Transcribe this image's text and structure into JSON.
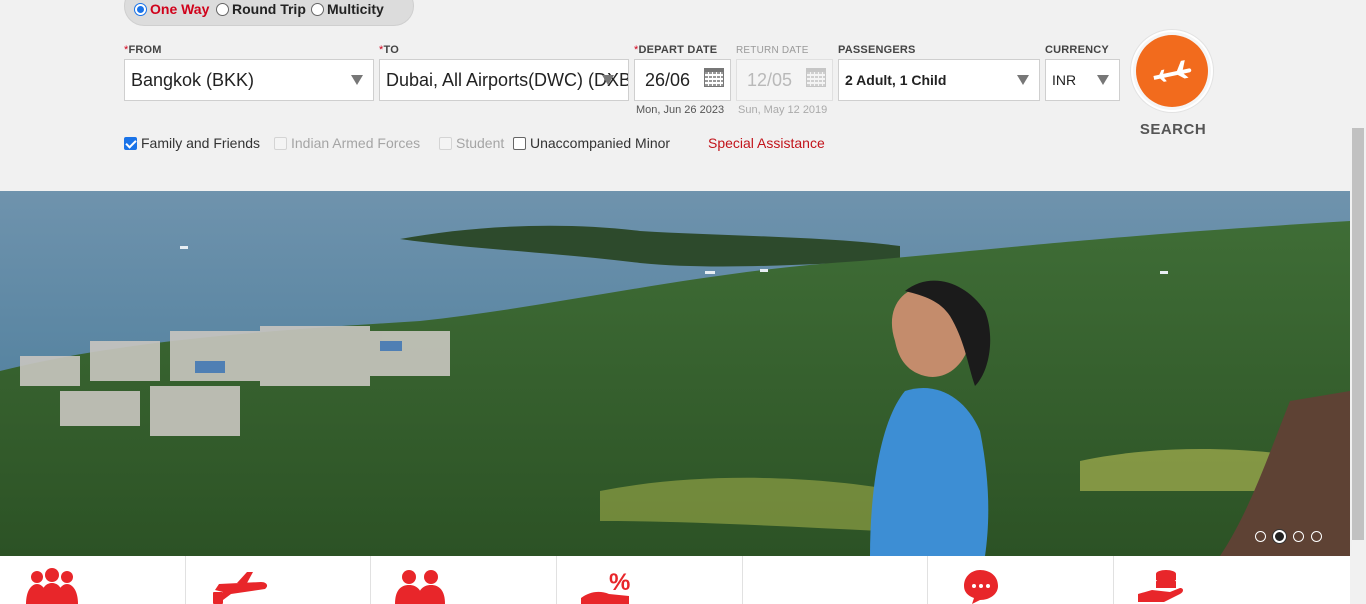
{
  "trip_types": [
    {
      "label": "One Way",
      "selected": true
    },
    {
      "label": "Round Trip",
      "selected": false
    },
    {
      "label": "Multicity",
      "selected": false
    }
  ],
  "form": {
    "from": {
      "required_mark": "*",
      "label": "FROM",
      "value": "Bangkok (BKK)"
    },
    "to": {
      "required_mark": "*",
      "label": "TO",
      "value": "Dubai, All Airports(DWC) (DXB"
    },
    "depart": {
      "required_mark": "*",
      "label": "DEPART DATE",
      "value": "26/06",
      "subtext": "Mon, Jun 26 2023"
    },
    "return": {
      "label": "RETURN DATE",
      "value": "12/05",
      "subtext": "Sun, May 12 2019",
      "disabled": true
    },
    "passengers": {
      "label": "PASSENGERS",
      "value": "2 Adult, 1 Child"
    },
    "currency": {
      "label": "CURRENCY",
      "value": "INR"
    }
  },
  "search": {
    "label": "SEARCH",
    "icon": "airplane-icon",
    "color": "#f26b1d"
  },
  "options": [
    {
      "label": "Family and Friends",
      "checked": true,
      "disabled": false
    },
    {
      "label": "Indian Armed Forces",
      "checked": false,
      "disabled": true
    },
    {
      "label": "Student",
      "checked": false,
      "disabled": true
    },
    {
      "label": "Unaccompanied Minor",
      "checked": false,
      "disabled": false
    }
  ],
  "special_assistance": "Special Assistance",
  "carousel": {
    "slides": 4,
    "active_index": 1
  },
  "quick_links": [
    {
      "icon": "group-icon"
    },
    {
      "icon": "plane-baggage-icon"
    },
    {
      "icon": "business-people-icon"
    },
    {
      "icon": "discount-offer-icon"
    },
    {
      "icon": "blank"
    },
    {
      "icon": "chat-support-icon"
    },
    {
      "icon": "coins-hand-icon"
    }
  ],
  "accent_color": "#e8262a"
}
